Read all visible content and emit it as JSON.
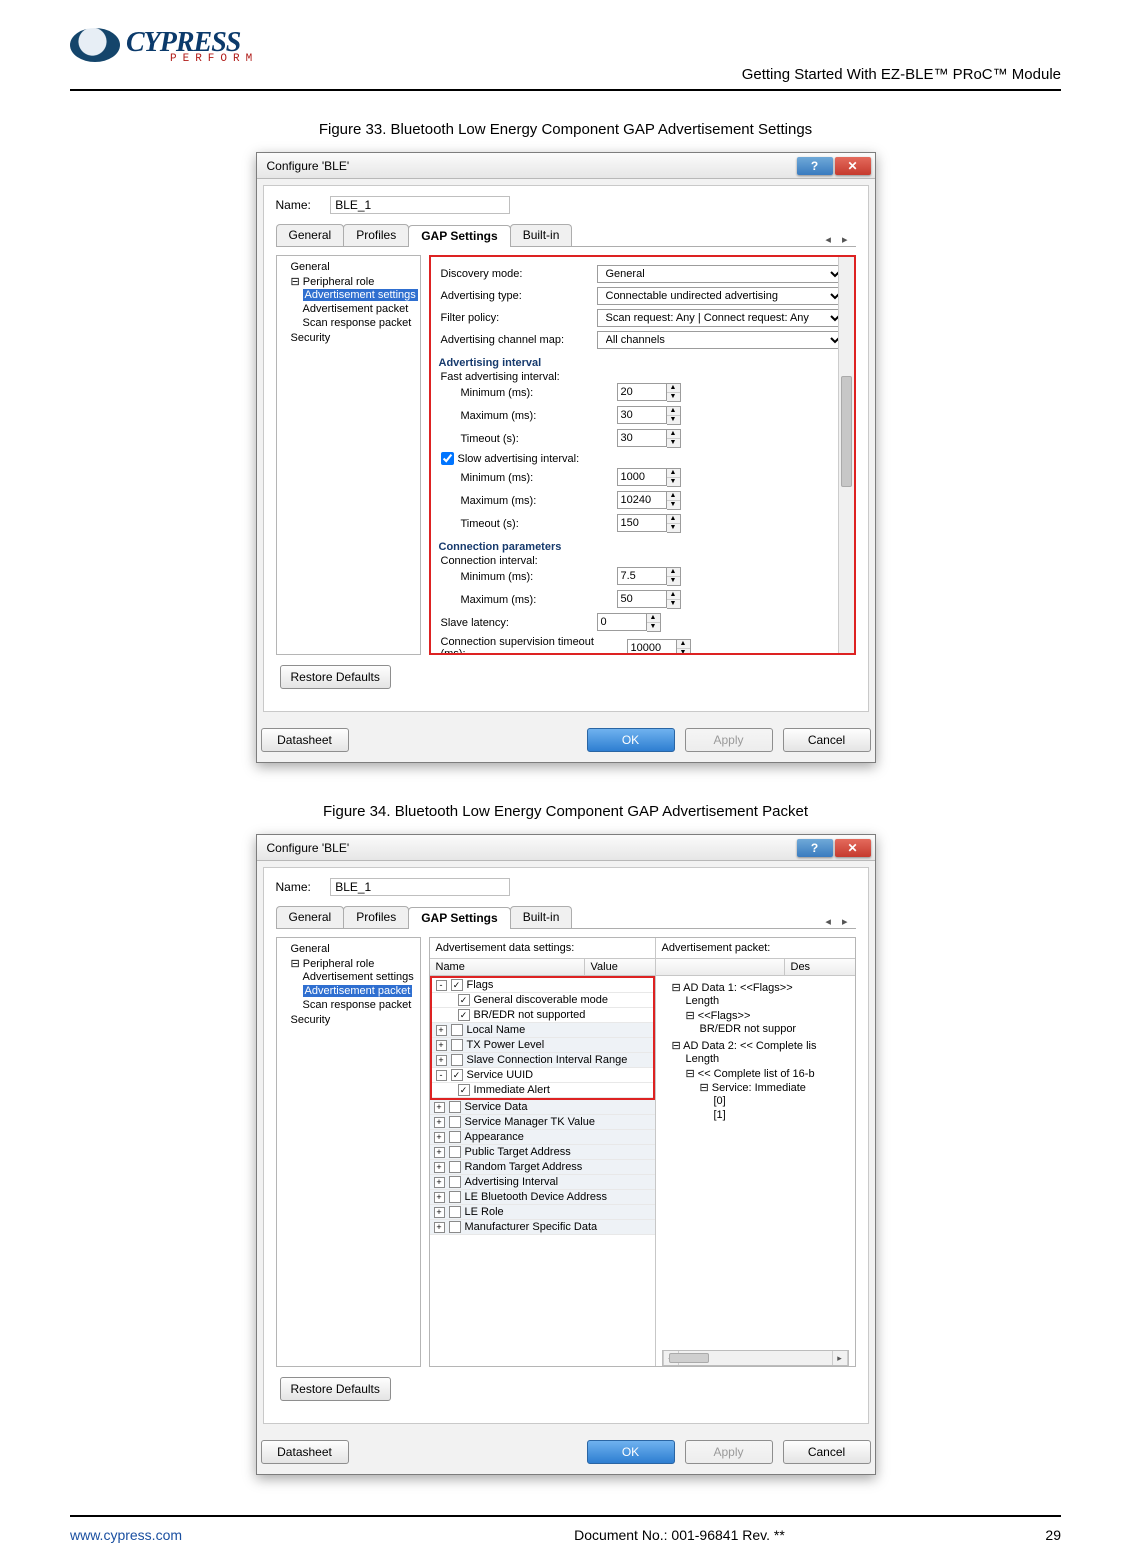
{
  "header": {
    "brand_main": "CYPRESS",
    "brand_sub": "PERFORM",
    "doc_title": "Getting Started With EZ-BLE™ PRoC™ Module"
  },
  "figure33": {
    "caption": "Figure 33. Bluetooth Low Energy Component GAP Advertisement Settings",
    "dialog_title": "Configure 'BLE'",
    "name_label": "Name:",
    "name_value": "BLE_1",
    "tabs": [
      "General",
      "Profiles",
      "GAP Settings",
      "Built-in"
    ],
    "active_tab": "GAP Settings",
    "tree": {
      "root": "General",
      "peripheral": "Peripheral role",
      "items": [
        "Advertisement settings",
        "Advertisement packet",
        "Scan response packet"
      ],
      "selected": "Advertisement settings",
      "security": "Security"
    },
    "form": {
      "discovery_mode_label": "Discovery mode:",
      "discovery_mode_value": "General",
      "advertising_type_label": "Advertising type:",
      "advertising_type_value": "Connectable undirected advertising",
      "filter_policy_label": "Filter policy:",
      "filter_policy_value": "Scan request: Any | Connect request: Any",
      "adv_channel_label": "Advertising channel map:",
      "adv_channel_value": "All channels",
      "adv_interval_head": "Advertising interval",
      "fast_head": "Fast advertising interval:",
      "min_label": "Minimum (ms):",
      "max_label": "Maximum (ms):",
      "timeout_label": "Timeout (s):",
      "fast_min": "20",
      "fast_max": "30",
      "fast_timeout": "30",
      "slow_chk_label": "Slow advertising interval:",
      "slow_min": "1000",
      "slow_max": "10240",
      "slow_timeout": "150",
      "conn_params_head": "Connection parameters",
      "conn_interval_head": "Connection interval:",
      "conn_min": "7.5",
      "conn_max": "50",
      "slave_latency_label": "Slave latency:",
      "slave_latency": "0",
      "sup_timeout_label": "Connection supervision timeout (ms):",
      "sup_timeout": "10000"
    },
    "restore_defaults": "Restore Defaults",
    "datasheet": "Datasheet",
    "ok": "OK",
    "apply": "Apply",
    "cancel": "Cancel"
  },
  "figure34": {
    "caption": "Figure 34. Bluetooth Low Energy Component GAP Advertisement Packet",
    "dialog_title": "Configure 'BLE'",
    "name_label": "Name:",
    "name_value": "BLE_1",
    "tabs": [
      "General",
      "Profiles",
      "GAP Settings",
      "Built-in"
    ],
    "active_tab": "GAP Settings",
    "tree": {
      "root": "General",
      "peripheral": "Peripheral role",
      "items": [
        "Advertisement settings",
        "Advertisement packet",
        "Scan response packet"
      ],
      "selected": "Advertisement packet",
      "security": "Security"
    },
    "left_head": "Advertisement data settings:",
    "grid_name": "Name",
    "grid_value": "Value",
    "adv_items": [
      {
        "label": "Flags",
        "checked": true,
        "exp": "-",
        "hi": true
      },
      {
        "label": "General discoverable mode",
        "checked": true,
        "sub": true,
        "hi": true
      },
      {
        "label": "BR/EDR not supported",
        "checked": true,
        "sub": true,
        "hi": true
      },
      {
        "label": "Local Name",
        "checked": false,
        "exp": "+"
      },
      {
        "label": "TX Power Level",
        "checked": false,
        "exp": "+"
      },
      {
        "label": "Slave Connection Interval Range",
        "checked": false,
        "exp": "+"
      },
      {
        "label": "Service UUID",
        "checked": true,
        "exp": "-",
        "hi": true
      },
      {
        "label": "Immediate Alert",
        "checked": true,
        "sub": true,
        "hi": true
      },
      {
        "label": "Service Data",
        "checked": false,
        "exp": "+"
      },
      {
        "label": "Service Manager TK Value",
        "checked": false,
        "exp": "+"
      },
      {
        "label": "Appearance",
        "checked": false,
        "exp": "+"
      },
      {
        "label": "Public Target Address",
        "checked": false,
        "exp": "+"
      },
      {
        "label": "Random Target Address",
        "checked": false,
        "exp": "+"
      },
      {
        "label": "Advertising Interval",
        "checked": false,
        "exp": "+"
      },
      {
        "label": "LE Bluetooth Device Address",
        "checked": false,
        "exp": "+"
      },
      {
        "label": "LE Role",
        "checked": false,
        "exp": "+"
      },
      {
        "label": "Manufacturer Specific Data",
        "checked": false,
        "exp": "+"
      }
    ],
    "right_head": "Advertisement packet:",
    "right_col": "Des",
    "pkt": {
      "d1": "AD Data 1: <<Flags>>",
      "d1_len": "Length",
      "d1_flags": "<<Flags>>",
      "d1_br": "BR/EDR not suppor",
      "d2": "AD Data 2: << Complete lis",
      "d2_len": "Length",
      "d2_list": "<< Complete list of 16-b",
      "d2_svc": "Service: Immediate",
      "d2_0": "[0]",
      "d2_1": "[1]"
    },
    "restore_defaults": "Restore Defaults",
    "datasheet": "Datasheet",
    "ok": "OK",
    "apply": "Apply",
    "cancel": "Cancel"
  },
  "footer": {
    "url": "www.cypress.com",
    "docno": "Document No.: 001-96841 Rev. **",
    "page": "29"
  }
}
